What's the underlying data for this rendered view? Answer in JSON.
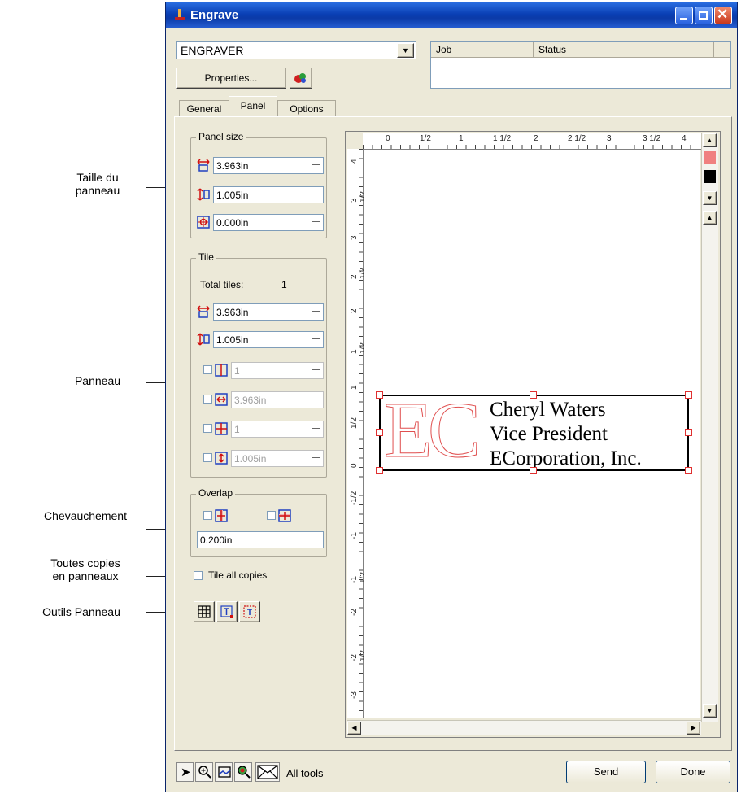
{
  "callouts": {
    "panel_size": [
      "Taille du",
      "panneau"
    ],
    "panel": "Panneau",
    "overlap": "Chevauchement",
    "tile_all": [
      "Toutes copies",
      "en panneaux"
    ],
    "tools": "Outils Panneau"
  },
  "window": {
    "title": "Engrave",
    "device": "ENGRAVER",
    "properties_label": "Properties...",
    "queue_headers": [
      "Job",
      "Status"
    ],
    "tabs": [
      "General",
      "Panel",
      "Options"
    ],
    "active_tab": "Panel"
  },
  "panel_size": {
    "label": "Panel size",
    "width": "3.963in",
    "height": "1.005in",
    "offset": "0.000in"
  },
  "tile": {
    "label": "Tile",
    "total_label": "Total tiles:",
    "total_value": "1",
    "width": "3.963in",
    "height": "1.005in",
    "cols": "1",
    "tile_width": "3.963in",
    "rows": "1",
    "tile_height": "1.005in"
  },
  "overlap": {
    "label": "Overlap",
    "value": "0.200in"
  },
  "tile_all_label": "Tile all copies",
  "ruler_h": [
    "0",
    "1/2",
    "1",
    "1 1/2",
    "2",
    "2 1/2",
    "3",
    "3 1/2",
    "4"
  ],
  "ruler_v": [
    "4",
    "3 1/2",
    "3",
    "2 1/2",
    "2",
    "1 1/2",
    "1",
    "1/2",
    "0",
    "-1/2",
    "-1",
    "-1 1/2",
    "-2",
    "-2 1/2",
    "-3"
  ],
  "design": {
    "monogram": "EC",
    "lines": [
      "Cheryl Waters",
      "Vice President",
      "ECorporation, Inc."
    ]
  },
  "colors": {
    "swatch1": "#f08080",
    "swatch2": "#000000",
    "titlebar": "#0a3fb4"
  },
  "bottom": {
    "all_tools": "All tools",
    "send": "Send",
    "done": "Done"
  }
}
